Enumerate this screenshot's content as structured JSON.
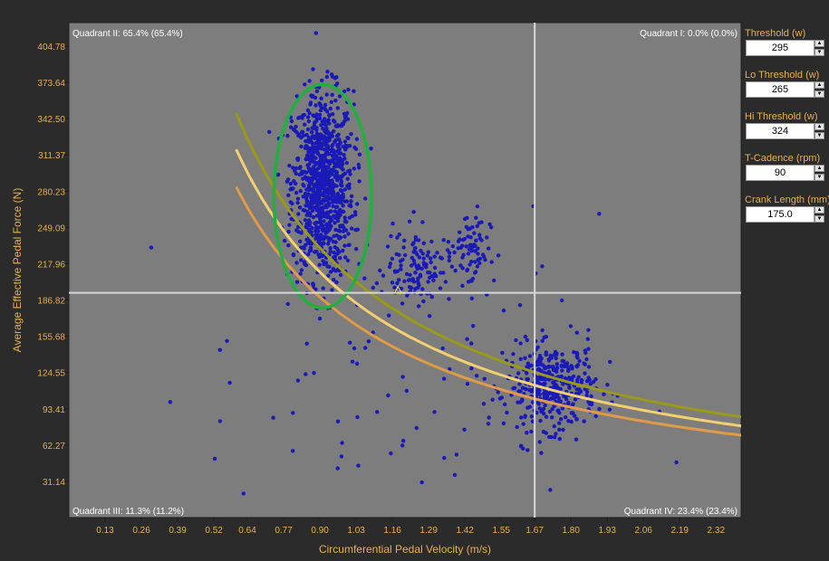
{
  "chart_data": {
    "type": "scatter",
    "xlabel": "Circumferential Pedal Velocity (m/s)",
    "ylabel": "Average Effective Pedal Force (N)",
    "x_ticks": [
      "0.13",
      "0.26",
      "0.39",
      "0.52",
      "0.64",
      "0.77",
      "0.90",
      "1.03",
      "1.16",
      "1.29",
      "1.42",
      "1.55",
      "1.67",
      "1.80",
      "1.93",
      "2.06",
      "2.19",
      "2.32"
    ],
    "y_ticks": [
      "404.78",
      "373.64",
      "342.50",
      "311.37",
      "280.23",
      "249.09",
      "217.96",
      "186.82",
      "155.68",
      "124.55",
      "93.41",
      "62.27",
      "31.14"
    ],
    "xlim": [
      0.0,
      2.41
    ],
    "ylim": [
      0.0,
      425.0
    ],
    "quadrants": {
      "q1": "Quadrant I: 0.0% (0.0%)",
      "q2": "Quadrant II: 65.4% (65.4%)",
      "q3": "Quadrant III: 11.3% (11.2%)",
      "q4": "Quadrant IV: 23.4% (23.4%)"
    },
    "crosshair": {
      "x": 1.67,
      "y": 193.0
    },
    "threshold_marker": {
      "x": 1.18,
      "y": 195.0
    },
    "clusters": [
      {
        "cx": 0.91,
        "cy": 285,
        "sx": 0.055,
        "sy": 40,
        "n": 950
      },
      {
        "cx": 1.73,
        "cy": 112,
        "sx": 0.08,
        "sy": 18,
        "n": 380
      },
      {
        "cx": 1.25,
        "cy": 215,
        "sx": 0.06,
        "sy": 15,
        "n": 120
      },
      {
        "cx": 1.44,
        "cy": 230,
        "sx": 0.035,
        "sy": 18,
        "n": 70
      },
      {
        "cx": 1.2,
        "cy": 120,
        "sx": 0.35,
        "sy": 70,
        "n": 90
      }
    ],
    "curves": [
      {
        "name": "",
        "power": 324,
        "color": "#9a9a18"
      },
      {
        "name": "",
        "power": 295,
        "color": "#f2d070"
      },
      {
        "name": "",
        "power": 265,
        "color": "#e09a48"
      }
    ],
    "ellipse": {
      "cx": 0.91,
      "cy": 276,
      "rx": 0.175,
      "ry": 96,
      "color": "#20b040"
    },
    "colors": {
      "plot_bg": "#7d7d7d",
      "dots": "#1a1ab8",
      "axis_text": "#e8b04a",
      "quadrant_text": "#ffffff",
      "crosshair": "#d8d8d8"
    }
  },
  "panel": {
    "fields": [
      {
        "label": "Threshold (w)",
        "value": "295"
      },
      {
        "label": "Lo Threshold (w)",
        "value": "265"
      },
      {
        "label": "Hi Threshold (w)",
        "value": "324"
      },
      {
        "label": "T-Cadence (rpm)",
        "value": "90"
      },
      {
        "label": "Crank Length (mm)",
        "value": "175.0"
      }
    ]
  }
}
